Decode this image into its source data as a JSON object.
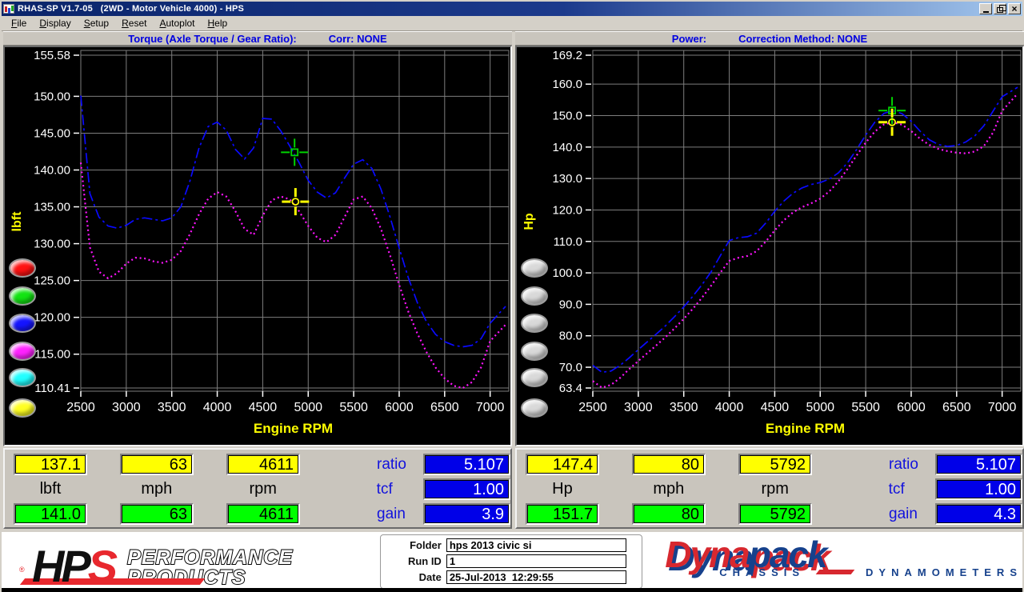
{
  "window": {
    "title": "RHAS-SP V1.7-05   (2WD - Motor Vehicle 4000) - HPS",
    "close_glyph": "×"
  },
  "menu": {
    "items": [
      {
        "label": "File"
      },
      {
        "label": "Display"
      },
      {
        "label": "Setup"
      },
      {
        "label": "Reset"
      },
      {
        "label": "Autoplot"
      },
      {
        "label": "Help"
      }
    ]
  },
  "chart_data": [
    {
      "type": "line",
      "title": "Torque (Axle Torque / Gear Ratio):",
      "corr_label": "Corr: NONE",
      "xlabel": "Engine RPM",
      "ylabel": "lbft",
      "xlim": [
        2500,
        7170
      ],
      "ylim": [
        110.41,
        155.58
      ],
      "grid": true,
      "legend": "none",
      "xticks": [
        {
          "value": 2500,
          "label": "2500"
        },
        {
          "value": 3000,
          "label": "3000"
        },
        {
          "value": 3500,
          "label": "3500"
        },
        {
          "value": 4000,
          "label": "4000"
        },
        {
          "value": 4500,
          "label": "4500"
        },
        {
          "value": 5000,
          "label": "5000"
        },
        {
          "value": 5500,
          "label": "5500"
        },
        {
          "value": 6000,
          "label": "6000"
        },
        {
          "value": 6500,
          "label": "6500"
        },
        {
          "value": 7000,
          "label": "7000"
        }
      ],
      "yticks": [
        {
          "value": 155.58,
          "label": "155.58"
        },
        {
          "value": 150.0,
          "label": "150.00"
        },
        {
          "value": 145.0,
          "label": "145.00"
        },
        {
          "value": 140.0,
          "label": "140.00"
        },
        {
          "value": 135.0,
          "label": "135.00"
        },
        {
          "value": 130.0,
          "label": "130.00"
        },
        {
          "value": 125.0,
          "label": "125.00"
        },
        {
          "value": 120.0,
          "label": "120.00"
        },
        {
          "value": 115.0,
          "label": "115.00"
        },
        {
          "value": 110.41,
          "label": "110.41"
        }
      ],
      "x": [
        2500,
        2600,
        2700,
        2800,
        2900,
        3000,
        3100,
        3200,
        3300,
        3400,
        3500,
        3600,
        3700,
        3800,
        3900,
        4000,
        4100,
        4200,
        4300,
        4400,
        4500,
        4600,
        4700,
        4800,
        4900,
        5000,
        5100,
        5200,
        5300,
        5400,
        5500,
        5600,
        5700,
        5800,
        5900,
        6000,
        6100,
        6200,
        6300,
        6400,
        6500,
        6600,
        6700,
        6800,
        6900,
        7000,
        7170
      ],
      "series": [
        {
          "name": "torque-blue-dashdot",
          "color": "#0a0aff",
          "style": "dashdot",
          "y": [
            150.1,
            136.8,
            133.6,
            132.4,
            132.1,
            132.5,
            133.3,
            133.5,
            133.3,
            133.1,
            133.5,
            135.0,
            138.5,
            143.0,
            145.9,
            146.5,
            145.4,
            142.8,
            141.5,
            143.0,
            147.0,
            146.9,
            145.3,
            143.2,
            141.0,
            138.6,
            137.0,
            136.2,
            136.9,
            138.9,
            140.8,
            141.4,
            140.2,
            137.4,
            133.6,
            129.4,
            125.4,
            122.0,
            119.4,
            117.7,
            116.7,
            116.2,
            116.0,
            116.2,
            117.1,
            119.2,
            121.5
          ]
        },
        {
          "name": "torque-magenta-dotted",
          "color": "#ff14ff",
          "style": "dot",
          "y": [
            141.0,
            129.5,
            126.2,
            125.3,
            126.0,
            127.3,
            128.1,
            128.0,
            127.6,
            127.4,
            127.8,
            129.0,
            131.3,
            134.0,
            136.1,
            137.0,
            136.4,
            134.4,
            132.0,
            131.2,
            133.8,
            135.9,
            136.4,
            136.0,
            134.4,
            132.4,
            130.8,
            130.2,
            131.2,
            133.6,
            136.0,
            136.4,
            134.8,
            132.0,
            128.4,
            124.4,
            120.8,
            117.8,
            115.3,
            113.2,
            111.7,
            110.7,
            110.4,
            111.2,
            113.2,
            116.8,
            119.0
          ]
        }
      ],
      "cursors": [
        {
          "name": "green-cursor",
          "shape": "square",
          "color": "#00d400",
          "x": 4850,
          "y": 142.4
        },
        {
          "name": "yellow-cursor",
          "shape": "circle",
          "color": "#ffff00",
          "x": 4860,
          "y": 135.7
        }
      ]
    },
    {
      "type": "line",
      "title": "Power:",
      "corr_label": "Correction Method: NONE",
      "xlabel": "Engine RPM",
      "ylabel": "Hp",
      "xlim": [
        2500,
        7170
      ],
      "ylim": [
        63.4,
        169.2
      ],
      "grid": true,
      "legend": "none",
      "xticks": [
        {
          "value": 2500,
          "label": "2500"
        },
        {
          "value": 3000,
          "label": "3000"
        },
        {
          "value": 3500,
          "label": "3500"
        },
        {
          "value": 4000,
          "label": "4000"
        },
        {
          "value": 4500,
          "label": "4500"
        },
        {
          "value": 5000,
          "label": "5000"
        },
        {
          "value": 5500,
          "label": "5500"
        },
        {
          "value": 6000,
          "label": "6000"
        },
        {
          "value": 6500,
          "label": "6500"
        },
        {
          "value": 7000,
          "label": "7000"
        }
      ],
      "yticks": [
        {
          "value": 169.2,
          "label": "169.2"
        },
        {
          "value": 160.0,
          "label": "160.0"
        },
        {
          "value": 150.0,
          "label": "150.0"
        },
        {
          "value": 140.0,
          "label": "140.0"
        },
        {
          "value": 130.0,
          "label": "130.0"
        },
        {
          "value": 120.0,
          "label": "120.0"
        },
        {
          "value": 110.0,
          "label": "110.0"
        },
        {
          "value": 100.0,
          "label": "100.0"
        },
        {
          "value": 90.0,
          "label": "90.0"
        },
        {
          "value": 80.0,
          "label": "80.0"
        },
        {
          "value": 70.0,
          "label": "70.0"
        },
        {
          "value": 63.4,
          "label": "63.4"
        }
      ],
      "x": [
        2500,
        2600,
        2700,
        2800,
        2900,
        3000,
        3100,
        3200,
        3300,
        3400,
        3500,
        3600,
        3700,
        3800,
        3900,
        4000,
        4100,
        4200,
        4300,
        4400,
        4500,
        4600,
        4700,
        4800,
        4900,
        5000,
        5100,
        5200,
        5300,
        5400,
        5500,
        5600,
        5700,
        5800,
        5900,
        6000,
        6100,
        6200,
        6300,
        6400,
        6500,
        6600,
        6700,
        6800,
        6900,
        7000,
        7170
      ],
      "series": [
        {
          "name": "power-blue-dashdot",
          "color": "#0a0aff",
          "style": "dashdot",
          "y": [
            70.6,
            68.4,
            68.8,
            70.6,
            73.0,
            75.6,
            78.1,
            80.6,
            83.2,
            86.1,
            89.2,
            92.6,
            96.2,
            100.3,
            105.4,
            110.3,
            111.2,
            111.5,
            112.6,
            115.8,
            119.6,
            122.8,
            125.3,
            127.0,
            128.1,
            128.7,
            129.8,
            131.8,
            135.0,
            139.2,
            143.8,
            147.9,
            150.7,
            151.6,
            150.6,
            148.2,
            145.0,
            142.3,
            140.8,
            140.2,
            140.5,
            141.6,
            143.6,
            146.8,
            151.4,
            156.0,
            159.0
          ]
        },
        {
          "name": "power-magenta-dotted",
          "color": "#ff14ff",
          "style": "dot",
          "y": [
            65.6,
            63.5,
            64.4,
            66.6,
            69.4,
            72.0,
            74.5,
            77.0,
            79.6,
            82.4,
            85.4,
            88.6,
            92.1,
            95.9,
            100.0,
            103.8,
            104.8,
            105.4,
            106.9,
            109.9,
            113.5,
            116.7,
            119.2,
            120.9,
            122.1,
            123.6,
            125.9,
            129.1,
            133.0,
            137.3,
            141.4,
            144.9,
            147.2,
            147.9,
            147.1,
            145.1,
            142.6,
            140.7,
            139.4,
            138.7,
            138.2,
            138.0,
            138.6,
            140.3,
            144.6,
            151.5,
            157.0
          ]
        }
      ],
      "cursors": [
        {
          "name": "green-cursor",
          "shape": "square",
          "color": "#00d400",
          "x": 5790,
          "y": 151.6
        },
        {
          "name": "yellow-cursor",
          "shape": "circle",
          "color": "#ffff00",
          "x": 5790,
          "y": 147.9
        }
      ]
    }
  ],
  "readouts": [
    {
      "name": "torque",
      "primary": {
        "color": "#ffff00",
        "values": [
          "137.1",
          "63",
          "4611"
        ]
      },
      "units": [
        "lbft",
        "mph",
        "rpm"
      ],
      "secondary": {
        "color": "#00ff00",
        "values": [
          "141.0",
          "63",
          "4611"
        ]
      },
      "params": [
        {
          "label": "ratio",
          "value": "5.107"
        },
        {
          "label": "tcf",
          "value": "1.00"
        },
        {
          "label": "gain",
          "value": "3.9"
        }
      ],
      "param_color": "#0000e8"
    },
    {
      "name": "power",
      "primary": {
        "color": "#ffff00",
        "values": [
          "147.4",
          "80",
          "5792"
        ]
      },
      "units": [
        "Hp",
        "mph",
        "rpm"
      ],
      "secondary": {
        "color": "#00ff00",
        "values": [
          "151.7",
          "80",
          "5792"
        ]
      },
      "params": [
        {
          "label": "ratio",
          "value": "5.107"
        },
        {
          "label": "tcf",
          "value": "1.00"
        },
        {
          "label": "gain",
          "value": "4.3"
        }
      ],
      "param_color": "#0000e8"
    }
  ],
  "side_buttons": {
    "left": [
      "#ff1212",
      "#12e412",
      "#1414ff",
      "#ff22ff",
      "#22ffff",
      "#ffff22"
    ],
    "right": [
      "#d9d9d9",
      "#d9d9d9",
      "#d9d9d9",
      "#d9d9d9",
      "#d9d9d9",
      "#d9d9d9"
    ]
  },
  "footer": {
    "hps": {
      "hp": "HP",
      "s": "S",
      "reg": "®",
      "line1": "PERFORMANCE",
      "line2": "PRODUCTS"
    },
    "form": {
      "rows": [
        {
          "label": "Folder",
          "value": "hps 2013 civic si"
        },
        {
          "label": "Run ID",
          "value": "1"
        },
        {
          "label": "Date",
          "value": "25-Jul-2013  12:29:55"
        }
      ]
    },
    "dynapack": {
      "word_a": "Dyna",
      "word_b": "pack",
      "sub_a": "CHASSIS",
      "sub_b": "DYNAMOMETERS"
    }
  }
}
